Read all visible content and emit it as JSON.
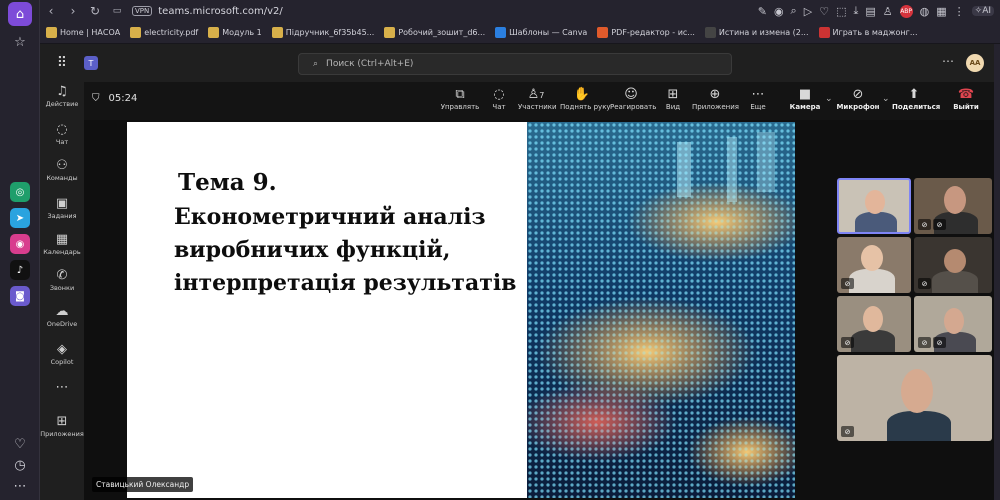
{
  "browser": {
    "url": "teams.microsoft.com/v2/",
    "vpn_label": "VPN",
    "abp_label": "ABP",
    "ai_label": "AI"
  },
  "bookmarks": [
    {
      "label": "Home | НАСОА",
      "icon": "folder-icon",
      "color": "#d8b04a"
    },
    {
      "label": "electricity.pdf",
      "icon": "folder-icon",
      "color": "#d8b04a"
    },
    {
      "label": "Модуль 1",
      "icon": "folder-icon",
      "color": "#d8b04a"
    },
    {
      "label": "Підручник_6f35b45...",
      "icon": "folder-icon",
      "color": "#d8b04a"
    },
    {
      "label": "Робочий_зошит_d6...",
      "icon": "folder-icon",
      "color": "#d8b04a"
    },
    {
      "label": "Шаблоны — Canva",
      "icon": "canva-icon",
      "color": "#2b7fe0"
    },
    {
      "label": "PDF-редактор - ис...",
      "icon": "pdf-editor-icon",
      "color": "#e05a2b"
    },
    {
      "label": "Истина и измена (2...",
      "icon": "spy-icon",
      "color": "#444444"
    },
    {
      "label": "Играть в маджонг...",
      "icon": "mahjong-icon",
      "color": "#cc3333"
    }
  ],
  "teams": {
    "search_placeholder": "Поиск (Ctrl+Alt+E)",
    "avatar_initials": "AA",
    "nav": [
      {
        "label": "Действие",
        "icon": "bell-icon"
      },
      {
        "label": "Чат",
        "icon": "chat-icon"
      },
      {
        "label": "Команды",
        "icon": "teams-icon"
      },
      {
        "label": "Задания",
        "icon": "assignments-icon"
      },
      {
        "label": "Календарь",
        "icon": "calendar-icon"
      },
      {
        "label": "Звонки",
        "icon": "phone-icon"
      },
      {
        "label": "OneDrive",
        "icon": "cloud-icon"
      },
      {
        "label": "Copilot",
        "icon": "copilot-icon"
      },
      {
        "label": "Приложения",
        "icon": "apps-icon"
      }
    ]
  },
  "meeting": {
    "elapsed": "05:24",
    "participants_count": "7",
    "toolbar": {
      "control": "Управлять",
      "chat": "Чат",
      "participants": "Участники",
      "raise_hand": "Поднять руку",
      "react": "Реагировать",
      "view": "Вид",
      "apps": "Приложения",
      "more": "Еще",
      "camera": "Камера",
      "mic": "Микрофон",
      "share": "Поделиться",
      "leave": "Выйти"
    },
    "presenter_name": "Ставицький Олександр"
  },
  "slide": {
    "title": "Тема 9.",
    "lines": [
      "Економетричний аналіз",
      "виробничих функцій,",
      "інтерпретація результатів"
    ]
  },
  "colors": {
    "accent": "#7d4bd8",
    "teams_brand": "#5b5fc7",
    "leave_red": "#e0454f"
  }
}
